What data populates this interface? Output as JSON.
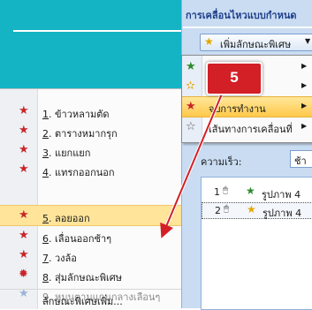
{
  "pane": {
    "title": "การเคลื่อนไหวแบบกำหนด",
    "add_effect_label": "เพิ่มลักษณะพิเศษ",
    "speed_label": "ความเร็ว:",
    "speed_value": "ช้า",
    "animations": [
      {
        "num": "1",
        "name": "รูปภาพ 4"
      },
      {
        "num": "2",
        "name": "รูปภาพ 4"
      }
    ]
  },
  "submenu": {
    "items": [
      {
        "label": "",
        "icon": "entrance-star-icon"
      },
      {
        "label": "",
        "icon": "emphasis-star-icon"
      },
      {
        "label": "จบการทำงาน",
        "icon": "exit-star-icon"
      },
      {
        "label": "เส้นทางการเคลื่อนที่",
        "icon": "motion-path-star-icon"
      }
    ]
  },
  "menu": {
    "items": [
      {
        "key": "1",
        "text": ". ข้าวหลามตัด"
      },
      {
        "key": "2",
        "text": ". ตารางหมากรุก"
      },
      {
        "key": "3",
        "text": ". แยกแยก"
      },
      {
        "key": "4",
        "text": ". แทรกออกนอก"
      },
      {
        "key": "5",
        "text": ". ลอยออก"
      },
      {
        "key": "6",
        "text": ". เลื่อนออกช้าๆ"
      },
      {
        "key": "7",
        "text": ". วงล้อ"
      },
      {
        "key": "8",
        "text": ". สุ่มลักษณะพิเศษ"
      },
      {
        "key": "9",
        "text": ". หมุนตามแกนกลางเลือนๆ"
      }
    ],
    "more_label": "ลักษณะพิเศษเพิ่ม..."
  },
  "callout": {
    "step_number": "5",
    "color": "#d31f26"
  }
}
